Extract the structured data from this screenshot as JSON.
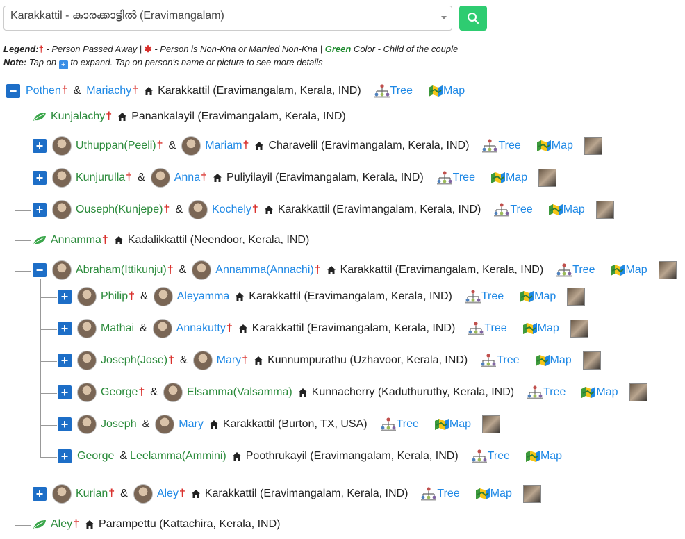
{
  "search": {
    "value": "Karakkattil - കാരക്കാട്ടിൽ (Eravimangalam)"
  },
  "legend": {
    "label": "Legend:",
    "dagger": "†",
    "passed": " - Person Passed Away | ",
    "star": "✱",
    "nonkna": " - Person is Non-Kna or Married Non-Kna | ",
    "green": "Green",
    "child": " Color - Child of the couple"
  },
  "note": {
    "label": "Note:",
    "pre": " Tap on ",
    "post": " to expand. Tap on person's name or picture to see more details"
  },
  "labels": {
    "tree": "Tree",
    "map": "Map",
    "amp": "&"
  },
  "rows": {
    "r0": {
      "p1": "Pothen",
      "p2": "Mariachy",
      "place": "Karakkattil (Eravimangalam, Kerala, IND)"
    },
    "r1": {
      "p1": "Kunjalachy",
      "place": "Panankalayil (Eravimangalam, Kerala, IND)"
    },
    "r2": {
      "p1": "Uthuppan(Peeli)",
      "p2": "Mariam",
      "place": "Charavelil (Eravimangalam, Kerala, IND)"
    },
    "r3": {
      "p1": "Kunjurulla",
      "p2": "Anna",
      "place": "Puliyilayil (Eravimangalam, Kerala, IND)"
    },
    "r4": {
      "p1": "Ouseph(Kunjepe)",
      "p2": "Kochely",
      "place": "Karakkattil (Eravimangalam, Kerala, IND)"
    },
    "r5": {
      "p1": "Annamma",
      "place": "Kadalikkattil (Neendoor, Kerala, IND)"
    },
    "r6": {
      "p1": "Abraham(Ittikunju)",
      "p2": "Annamma(Annachi)",
      "place": "Karakkattil (Eravimangalam, Kerala, IND)"
    },
    "r7": {
      "p1": "Philip",
      "p2": "Aleyamma",
      "place": "Karakkattil (Eravimangalam, Kerala, IND)"
    },
    "r8": {
      "p1": "Mathai",
      "p2": "Annakutty",
      "place": "Karakkattil (Eravimangalam, Kerala, IND)"
    },
    "r9": {
      "p1": "Joseph(Jose)",
      "p2": "Mary",
      "place": "Kunnumpurathu (Uzhavoor, Kerala, IND)"
    },
    "r10": {
      "p1": "George",
      "p2": "Elsamma(Valsamma)",
      "place": "Kunnacherry (Kaduthuruthy, Kerala, IND)"
    },
    "r11": {
      "p1": "Joseph",
      "p2": "Mary",
      "place": "Karakkattil (Burton, TX, USA)"
    },
    "r12": {
      "p1": "George",
      "p2": "Leelamma(Ammini)",
      "place": "Poothrukayil (Eravimangalam, Kerala, IND)"
    },
    "r13": {
      "p1": "Kurian",
      "p2": "Aley",
      "place": "Karakkattil (Eravimangalam, Kerala, IND)"
    },
    "r14": {
      "p1": "Aley",
      "place": "Parampettu (Kattachira, Kerala, IND)"
    }
  },
  "colors": {
    "accent": "#1d6ec7",
    "search_button": "#2ecc71",
    "child": "#2a8a3a",
    "spouse": "#1e88e5",
    "deceased": "#d9302c"
  },
  "icons": [
    "search-icon",
    "home-icon",
    "leaf-icon",
    "tree-icon",
    "map-icon",
    "caret-down-icon"
  ]
}
